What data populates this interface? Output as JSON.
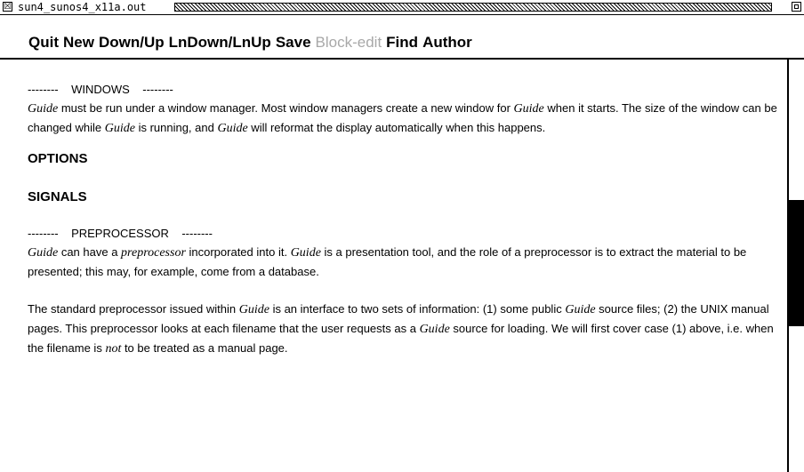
{
  "window": {
    "title": "sun4_sunos4_x11a.out",
    "close_glyph": "☒"
  },
  "menu": {
    "items": [
      "Quit",
      "New",
      "Down/Up",
      "LnDown/LnUp",
      "Save",
      "Block-edit",
      "Find",
      "Author"
    ],
    "disabled": [
      "Block-edit"
    ]
  },
  "doc": {
    "windows_sep": "--------    WINDOWS    --------",
    "windows_p": {
      "guide": "Guide",
      "t1": " must be run under a window manager.  Most window managers create a new window for ",
      "t2": " when it starts.  The size of the window can be changed while ",
      "t3": " is running, and ",
      "t4": " will reformat the display automatically when this happens."
    },
    "options_heading": "OPTIONS",
    "signals_heading": "SIGNALS",
    "preprocessor_sep": "--------    PREPROCESSOR    --------",
    "pre_p1": {
      "guide": "Guide",
      "t1": " can have a ",
      "preprocessor": "preprocessor",
      "t2": " incorporated into it.  ",
      "t3": " is a presentation tool, and the role of a preprocessor is to extract the material to be presented; this may, for example, come from a database."
    },
    "pre_p2": {
      "guide": "Guide",
      "not": "not",
      "t1": "The standard preprocessor issued within ",
      "t2": " is an interface to two sets of information: (1) some public ",
      "t3": " source files; (2) the UNIX manual pages.  This preprocessor looks at each filename that the user requests as a ",
      "t4": " source for loading.  We will first cover case (1) above, i.e. when the filename is ",
      "t5": " to be treated as a manual page."
    }
  }
}
